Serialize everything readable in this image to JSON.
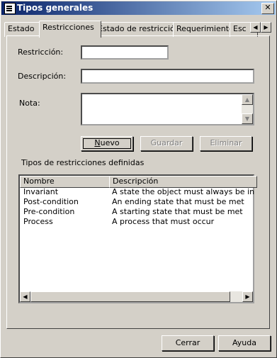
{
  "window": {
    "title": "Tipos generales",
    "close_label": "✕"
  },
  "tabs": [
    "Estado",
    "Restricciones",
    "Estado de restricción",
    "Requerimiento",
    "Esc"
  ],
  "tab_scroll": {
    "left": "◀",
    "right": "▶"
  },
  "form": {
    "restriccion_label": "Restricción:",
    "restriccion_value": "",
    "descripcion_label": "Descripción:",
    "descripcion_value": "",
    "nota_label": "Nota:",
    "nota_value": ""
  },
  "buttons": {
    "nuevo_prefix": "N",
    "nuevo_rest": "uevo",
    "guardar": "Guardar",
    "eliminar": "Eliminar"
  },
  "list": {
    "title": "Tipos de restricciones definidas",
    "columns": [
      "Nombre",
      "Descripción"
    ],
    "rows": [
      [
        "Invariant",
        "A state the object must always be in"
      ],
      [
        "Post-condition",
        "An ending state that must be met"
      ],
      [
        "Pre-condition",
        "A starting state that must be met"
      ],
      [
        "Process",
        "A process that must occur"
      ]
    ]
  },
  "scroll_arrows": {
    "up": "▲",
    "down": "▼",
    "left": "◀",
    "right": "▶"
  },
  "footer": {
    "cerrar": "Cerrar",
    "ayuda": "Ayuda"
  }
}
